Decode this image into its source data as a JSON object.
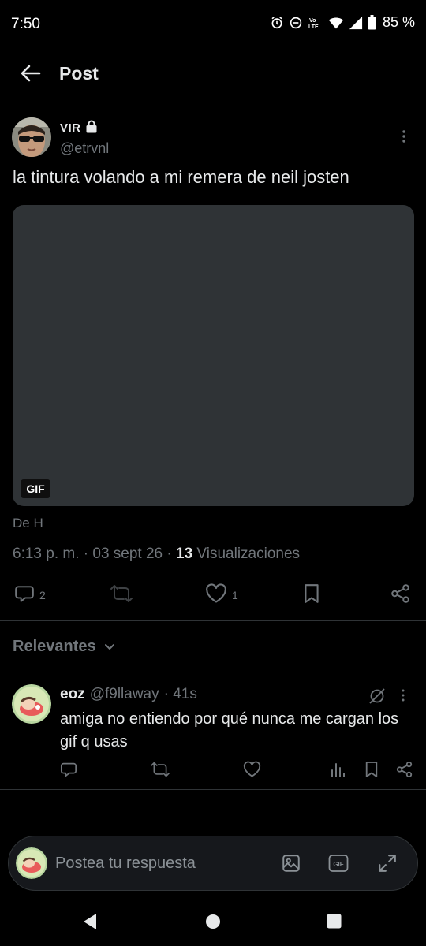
{
  "status_bar": {
    "time": "7:50",
    "battery": "85 %",
    "icons": [
      "alarm-icon",
      "do-not-disturb-icon",
      "volte-icon",
      "wifi-icon",
      "signal-icon",
      "battery-icon"
    ]
  },
  "header": {
    "title": "Post",
    "back_icon": "arrow-left-icon"
  },
  "post": {
    "author_name": "VIR",
    "author_handle": "@etrvnl",
    "locked": true,
    "text": "la tintura volando a mi remera de neil josten",
    "media_badge": "GIF",
    "source": "De H",
    "timestamp": "6:13 p. m. · 03 sept 26 · ",
    "views_count": "13",
    "views_label": " Visualizaciones",
    "actions": {
      "reply_count": "2",
      "repost_count": "",
      "like_count": "1"
    }
  },
  "replies_section": {
    "sort_label": "Relevantes"
  },
  "reply": {
    "name": "eoz",
    "handle": "@f9llaway",
    "time": "· 41s",
    "text": "amiga no entiendo por qué nunca me cargan los gif q usas"
  },
  "composer": {
    "placeholder": "Postea tu respuesta"
  },
  "colors": {
    "background": "#000000",
    "text_primary": "#e7e9ea",
    "text_secondary": "#71767b",
    "media_placeholder": "#2f3336"
  }
}
